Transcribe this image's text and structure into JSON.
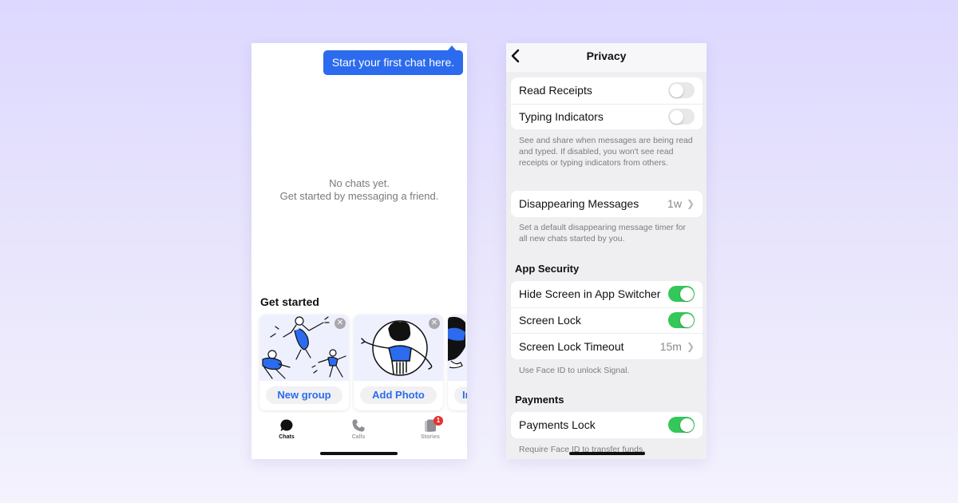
{
  "chats_screen": {
    "tooltip": "Start your first chat here.",
    "empty_state": {
      "line1": "No chats yet.",
      "line2": "Get started by messaging a friend."
    },
    "get_started": {
      "title": "Get started",
      "cards": [
        {
          "label": "New group",
          "illustration": "people-jumping-illustration"
        },
        {
          "label": "Add Photo",
          "illustration": "profile-photo-illustration"
        },
        {
          "label": "In",
          "illustration": "person-illustration-partial"
        }
      ]
    },
    "tabbar": {
      "tabs": [
        {
          "label": "Chats",
          "icon": "chat-bubble-icon",
          "active": true
        },
        {
          "label": "Calls",
          "icon": "phone-icon",
          "active": false
        },
        {
          "label": "Stories",
          "icon": "stories-icon",
          "active": false,
          "badge": "1"
        }
      ]
    }
  },
  "privacy_screen": {
    "title": "Privacy",
    "groups": {
      "receipts": [
        {
          "label": "Read Receipts",
          "type": "toggle",
          "on": false
        },
        {
          "label": "Typing Indicators",
          "type": "toggle",
          "on": false
        }
      ],
      "receipts_footnote": "See and share when messages are being read and typed. If disabled, you won't see read receipts or typing indicators from others.",
      "disappearing": {
        "label": "Disappearing Messages",
        "value": "1w"
      },
      "disappearing_footnote": "Set a default disappearing message timer for all new chats started by you.",
      "app_security_header": "App Security",
      "app_security": [
        {
          "label": "Hide Screen in App Switcher",
          "type": "toggle",
          "on": true
        },
        {
          "label": "Screen Lock",
          "type": "toggle",
          "on": true
        },
        {
          "label": "Screen Lock Timeout",
          "type": "value",
          "value": "15m"
        }
      ],
      "app_security_footnote": "Use Face ID to unlock Signal.",
      "payments_header": "Payments",
      "payments": [
        {
          "label": "Payments Lock",
          "type": "toggle",
          "on": true
        }
      ],
      "payments_footnote": "Require Face ID to transfer funds."
    }
  },
  "colors": {
    "accent": "#2c6bed",
    "toggle_on": "#34c759",
    "toggle_off": "#e8e8ea",
    "badge": "#e5322d"
  }
}
